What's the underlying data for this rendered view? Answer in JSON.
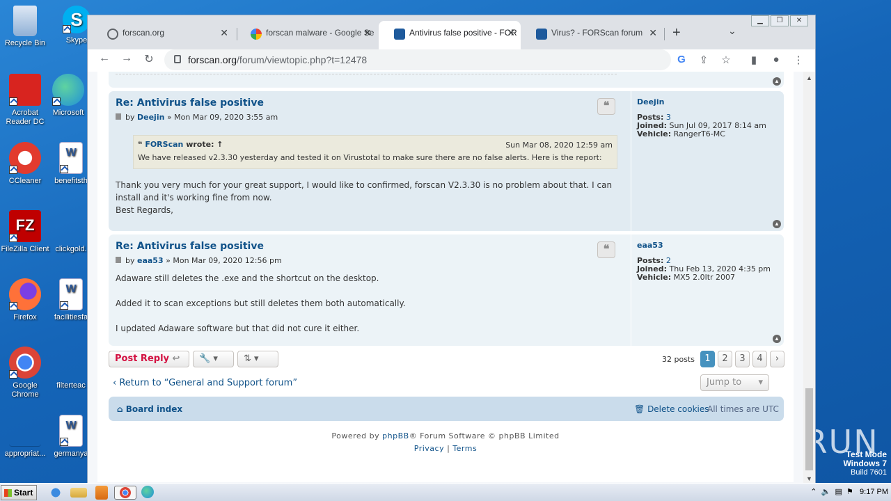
{
  "desktop": {
    "icons": [
      {
        "label": "Recycle Bin",
        "color": "#7aa6d6"
      },
      {
        "label": "Skype",
        "color": "#00aff0"
      },
      {
        "label": "Acrobat Reader DC",
        "color": "#d8241f"
      },
      {
        "label": "Microsoft",
        "color": "#1f8fd8"
      },
      {
        "label": "CCleaner",
        "color": "#e23b2e"
      },
      {
        "label": "benefitsth",
        "color": "#ffffff"
      },
      {
        "label": "FileZilla Client",
        "color": "#bf0000"
      },
      {
        "label": "clickgold.",
        "color": "#ffffff"
      },
      {
        "label": "Firefox",
        "color": "#ff7139"
      },
      {
        "label": "facilitiesfa",
        "color": "#ffffff"
      },
      {
        "label": "Google Chrome",
        "color": "#4285f4"
      },
      {
        "label": "filterteac",
        "color": "#ffffff"
      },
      {
        "label": "appropriat...",
        "color": "#1a6fc0"
      },
      {
        "label": "germanya",
        "color": "#ffffff"
      }
    ],
    "watermark": "ANY RUN",
    "test_mode": {
      "line1": "Test Mode",
      "line2": "Windows 7",
      "line3": "Build 7601"
    }
  },
  "browser": {
    "tabs": [
      {
        "title": "forscan.org",
        "favicon": "globe-icon"
      },
      {
        "title": "forscan malware - Google Se",
        "favicon": "google-icon"
      },
      {
        "title": "Antivirus false positive - FOR",
        "favicon": "forscan-icon",
        "active": true
      },
      {
        "title": "Virus? - FORScan forum",
        "favicon": "forscan-icon"
      }
    ],
    "url_host": "forscan.org",
    "url_path": "/forum/viewtopic.php?t=12478"
  },
  "posts": [
    {
      "title": "Re: Antivirus false positive",
      "by": "by",
      "author": "Deejin",
      "date": "» Mon Mar 09, 2020 3:55 am",
      "quote": {
        "author": "FORScan",
        "wrote": "wrote: ↑",
        "date": "Sun Mar 08, 2020 12:59 am",
        "text": "We have released v2.3.30 yesterday and tested it on Virustotal to make sure there are no false alerts. Here is the report:"
      },
      "body": [
        "Thank you very much for your great support, I would like to confirmed, forscan V2.3.30 is no problem about that. I can",
        "install and it's working fine from now.",
        "Best Regards,"
      ],
      "profile": {
        "name": "Deejin",
        "posts_label": "Posts:",
        "posts": "3",
        "joined_label": "Joined:",
        "joined": "Sun Jul 09, 2017 8:14 am",
        "vehicle_label": "Vehicle:",
        "vehicle": "RangerT6-MC"
      }
    },
    {
      "title": "Re: Antivirus false positive",
      "by": "by",
      "author": "eaa53",
      "date": "» Mon Mar 09, 2020 12:56 pm",
      "body": [
        "Adaware still deletes the .exe and the shortcut on the desktop.",
        "Added it to scan exceptions but still deletes them both automatically.",
        "I updated Adaware software but that did not cure it either."
      ],
      "profile": {
        "name": "eaa53",
        "posts_label": "Posts:",
        "posts": "2",
        "joined_label": "Joined:",
        "joined": "Thu Feb 13, 2020 4:35 pm",
        "vehicle_label": "Vehicle:",
        "vehicle": "MX5 2.0ltr 2007"
      }
    }
  ],
  "actions": {
    "post_reply": "Post Reply",
    "posts_count": "32 posts",
    "pages": [
      "1",
      "2",
      "3",
      "4"
    ],
    "current_page": "1",
    "return_link": "Return to “General and Support forum”",
    "jump_to": "Jump to"
  },
  "navbar": {
    "board_index": "Board index",
    "delete_cookies": "Delete cookies",
    "timezone": "All times are UTC"
  },
  "footer": {
    "powered_prefix": "Powered by",
    "phpbb": "phpBB",
    "powered_suffix": "® Forum Software © phpBB Limited",
    "privacy": "Privacy",
    "sep": "|",
    "terms": "Terms"
  },
  "taskbar": {
    "start": "Start",
    "clock": "9:17 PM"
  }
}
